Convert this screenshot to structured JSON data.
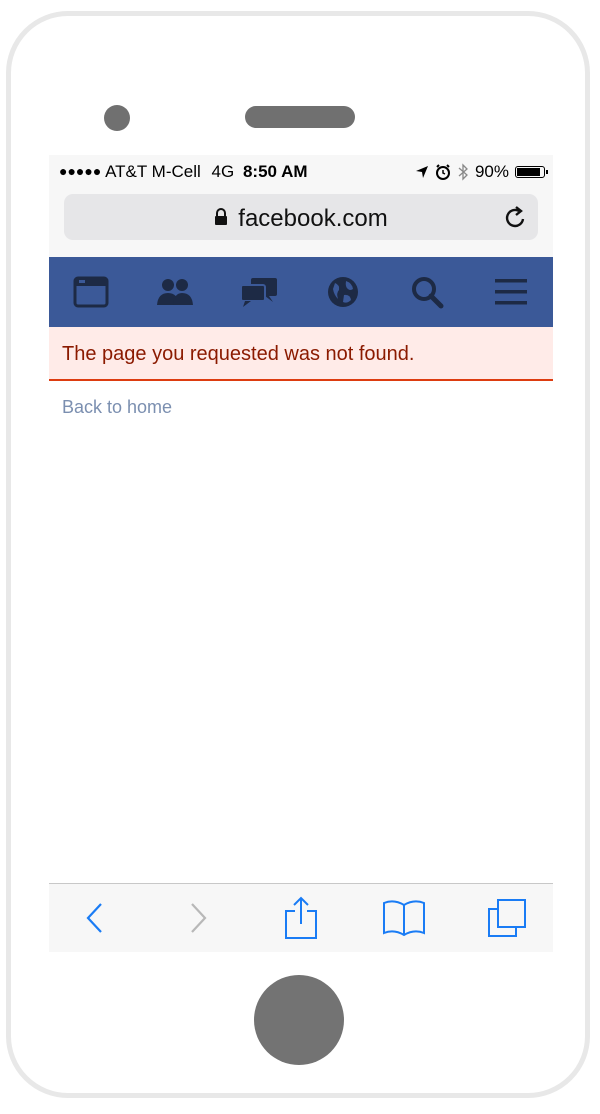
{
  "statusbar": {
    "signal": "●●●●●",
    "carrier": "AT&T M-Cell",
    "network": "4G",
    "time": "8:50 AM",
    "battery": "90%",
    "battery_level": 0.9,
    "icons": [
      "location-arrow-icon",
      "alarm-icon",
      "bluetooth-icon",
      "battery-icon"
    ]
  },
  "urlbar": {
    "url": "facebook.com",
    "icons": [
      "lock-icon",
      "reload-icon"
    ]
  },
  "fb_nav": {
    "color": "#3b5998",
    "icons": [
      "news-feed-icon",
      "friend-requests-icon",
      "messages-icon",
      "notifications-globe-icon",
      "search-icon",
      "menu-icon"
    ]
  },
  "error": {
    "message": "The page you requested was not found.",
    "background": "#ffebe8",
    "border": "#dd3c10"
  },
  "back_link": "Back to home",
  "toolbar": {
    "icons": [
      "back-icon",
      "forward-icon",
      "share-icon",
      "bookmarks-icon",
      "tabs-icon"
    ],
    "accent": "#1a7cf5"
  }
}
